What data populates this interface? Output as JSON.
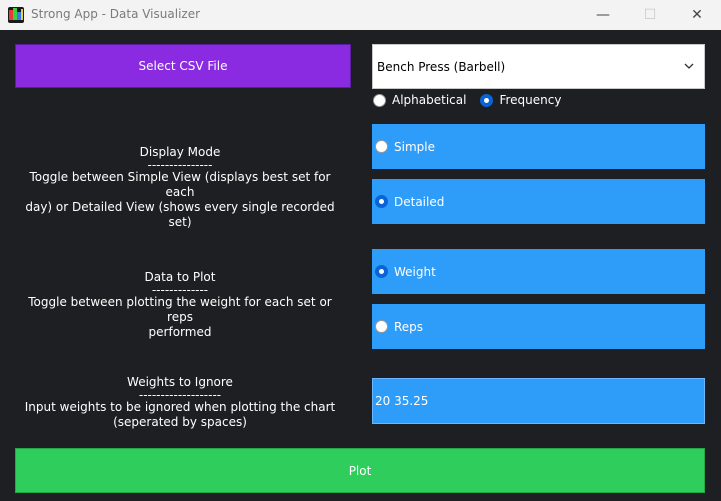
{
  "window": {
    "title": "Strong App - Data Visualizer",
    "minimize_glyph": "—",
    "maximize_glyph": "☐",
    "close_glyph": "✕"
  },
  "csv_button": {
    "label": "Select CSV File",
    "color": "#8a2be2"
  },
  "exercise_select": {
    "value": "Bench Press (Barbell)"
  },
  "sort": {
    "options": [
      {
        "label": "Alphabetical",
        "checked": false
      },
      {
        "label": "Frequency",
        "checked": true
      }
    ]
  },
  "display_mode": {
    "title": "Display Mode",
    "divider": "---------------",
    "description_line1": "Toggle between Simple View (displays best set for each",
    "description_line2": "day) or Detailed View (shows every single recorded set)",
    "options": [
      {
        "label": "Simple",
        "checked": false
      },
      {
        "label": "Detailed",
        "checked": true
      }
    ]
  },
  "data_to_plot": {
    "title": "Data to Plot",
    "divider": "-------------",
    "description_line1": "Toggle between plotting the weight for each set or reps",
    "description_line2": "performed",
    "options": [
      {
        "label": "Weight",
        "checked": true
      },
      {
        "label": "Reps",
        "checked": false
      }
    ]
  },
  "weights_ignore": {
    "title": "Weights to Ignore",
    "divider": "-------------------",
    "description_line1": "Input weights to be ignored when plotting the chart",
    "description_line2": "(seperated by spaces)",
    "value": "20 35.25"
  },
  "plot_button": {
    "label": "Plot",
    "color": "#2fce5c"
  },
  "colors": {
    "option_bg": "#2e9cf9",
    "background": "#1e1f22",
    "radio_checked": "#0a64d8"
  }
}
